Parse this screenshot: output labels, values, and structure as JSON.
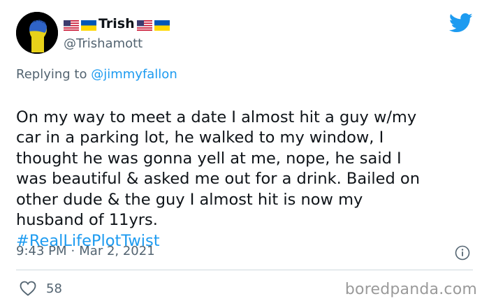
{
  "author": {
    "display_name": "Trish",
    "handle": "@Trishamott"
  },
  "reply": {
    "prefix": "Replying to",
    "mention": "@jimmyfallon"
  },
  "tweet": {
    "text": "On my way to meet a date I almost hit a guy w/my\ncar in a parking lot, he walked to my window, I\nthought he was gonna yell at me, nope, he said I\nwas beautiful & asked me out for a drink. Bailed on\nother dude & the guy I almost hit is now my\nhusband of 11yrs.",
    "hashtag": "#RealLifePlotTwist"
  },
  "meta": {
    "time": "9:43 PM",
    "separator": "·",
    "date": "Mar 2, 2021"
  },
  "engagement": {
    "likes": "58"
  },
  "watermark": "boredpanda.com",
  "colors": {
    "link_blue": "#1d9bf0",
    "secondary_text": "#536471",
    "divider": "#cfd9de"
  },
  "icons": [
    "twitter-bird-icon",
    "info-icon",
    "heart-icon",
    "us-flag-icon",
    "ukraine-flag-icon"
  ]
}
